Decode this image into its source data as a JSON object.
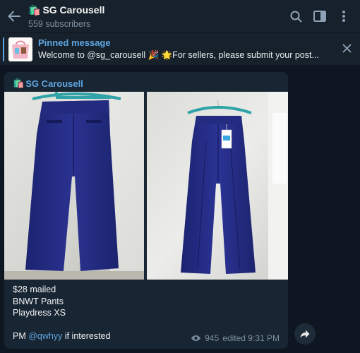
{
  "header": {
    "title": "SG Carousell",
    "title_emoji": "🛍️",
    "subscribers": "559 subscribers",
    "icons": [
      "back-arrow-icon",
      "search-icon",
      "sidebar-toggle-icon",
      "more-vertical-icon"
    ]
  },
  "pinned": {
    "label": "Pinned message",
    "message": "Welcome to @sg_carousell 🎉  🌟For sellers, please submit your post...",
    "close_icon": "close-icon"
  },
  "message": {
    "sender": "SG Carousell",
    "sender_emoji": "🛍️",
    "caption_lines": [
      "$28 mailed",
      "BNWT Pants",
      "Playdress XS"
    ],
    "pm_prefix": "PM ",
    "pm_mention": "@qwhyy",
    "pm_suffix": " if interested",
    "views": "945",
    "edited": "edited 9:31 PM",
    "share_icon": "share-arrow-icon"
  },
  "colors": {
    "background": "#0e1621",
    "header": "#17212b",
    "bubble": "#182533",
    "accent": "#5ea5e0",
    "muted": "#7d8e9e"
  }
}
